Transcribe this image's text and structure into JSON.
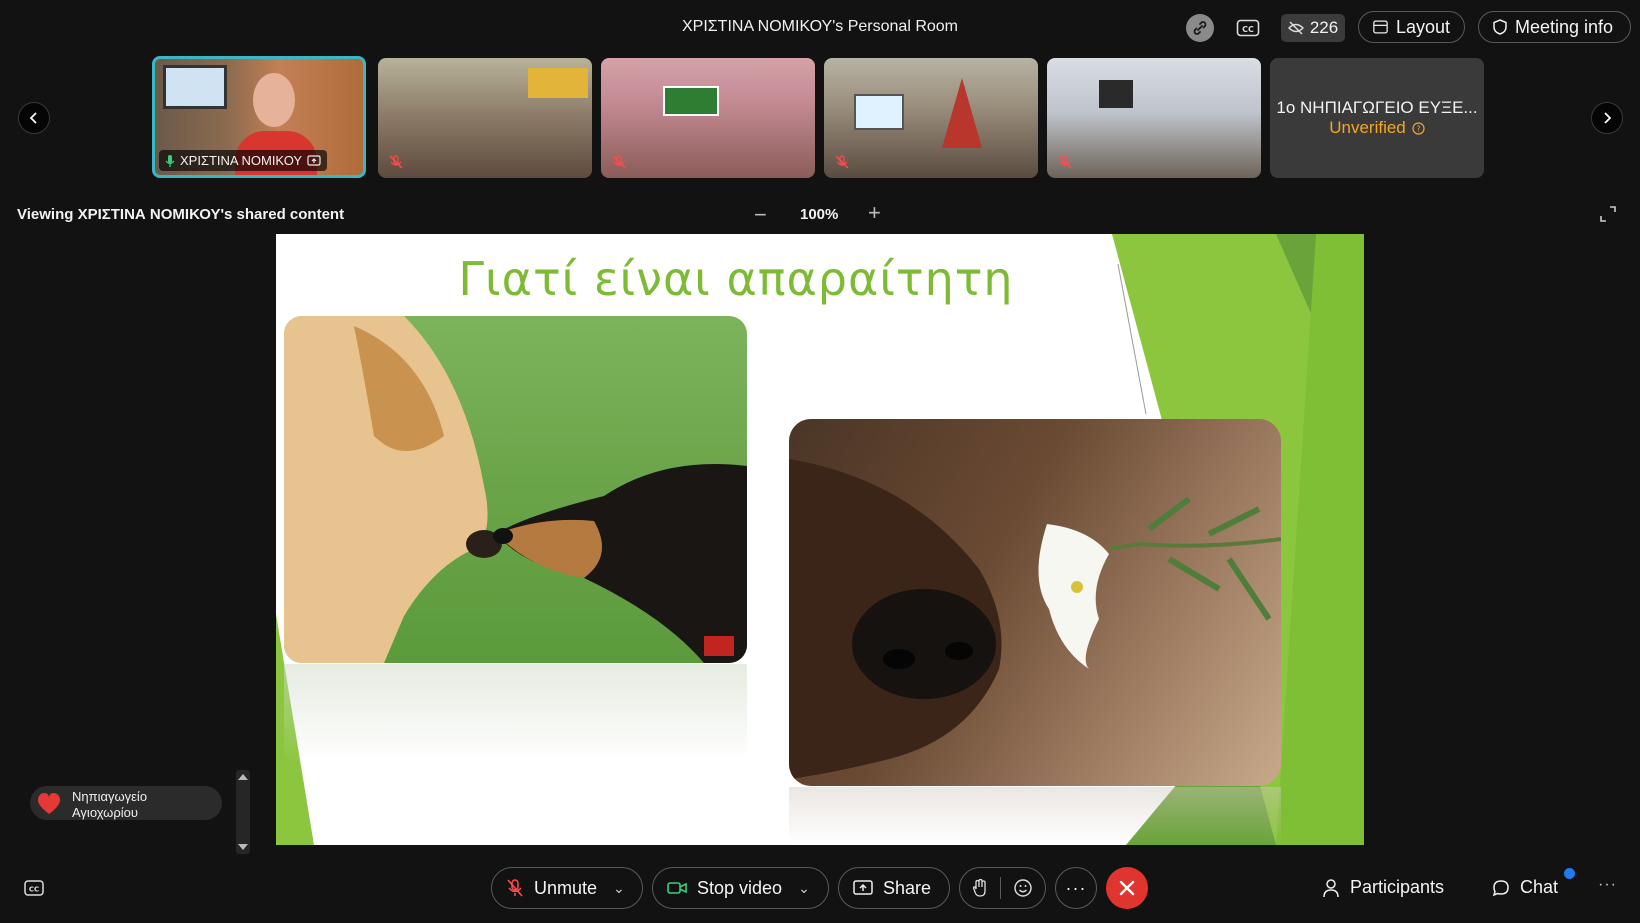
{
  "header": {
    "room_title": "ΧΡΙΣΤΙΝΑ ΝΟΜΙΚΟΥ's Personal Room",
    "participant_count": "226",
    "layout_label": "Layout",
    "meeting_info_label": "Meeting info"
  },
  "thumbnails": {
    "presenter_name": "ΧΡΙΣΤΙΝΑ ΝΟΜΙΚΟΥ",
    "unverified_name": "1ο ΝΗΠΙΑΓΩΓΕΙΟ ΕΥΞΕ...",
    "unverified_status": "Unverified"
  },
  "share_bar": {
    "viewing_label": "Viewing ΧΡΙΣΤΙΝΑ ΝΟΜΙΚΟΥ's shared content",
    "zoom_minus": "−",
    "zoom_level": "100%",
    "zoom_plus": "+"
  },
  "slide": {
    "title": "Γιατί είναι απαραίτητη"
  },
  "reaction": {
    "name": "Νηπιαγωγείο Αγιοχωρίου"
  },
  "controls": {
    "unmute_label": "Unmute",
    "stop_video_label": "Stop video",
    "share_label": "Share",
    "participants_label": "Participants",
    "chat_label": "Chat",
    "more_label": "···"
  },
  "colors": {
    "accent_teal": "#3ab7c2",
    "slide_green": "#7dbb34",
    "unverified_orange": "#f5a623",
    "end_red": "#e0342f",
    "notification_blue": "#1e7cf2"
  }
}
